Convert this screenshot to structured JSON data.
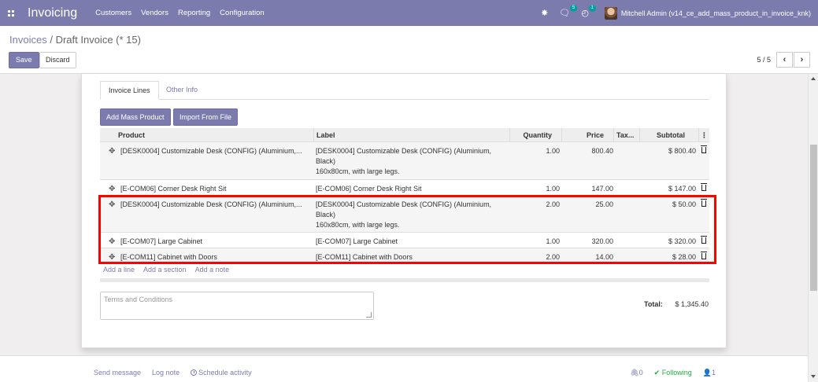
{
  "app": {
    "title": "Invoicing"
  },
  "nav": {
    "menu": [
      "Customers",
      "Vendors",
      "Reporting",
      "Configuration"
    ],
    "messages_count": "5",
    "activities_count": "1",
    "user": "Mitchell Admin (v14_ce_add_mass_product_in_invoice_knk)"
  },
  "breadcrumb": {
    "parent": "Invoices",
    "separator": "/",
    "current": "Draft Invoice (* 15)"
  },
  "actions": {
    "save": "Save",
    "discard": "Discard"
  },
  "pager": {
    "value": "5 / 5"
  },
  "tabs": [
    "Invoice Lines",
    "Other Info"
  ],
  "buttons": {
    "add_mass_product": "Add Mass Product",
    "import_from_file": "Import From File"
  },
  "columns": {
    "product": "Product",
    "label": "Label",
    "quantity": "Quantity",
    "price": "Price",
    "taxes": "Tax...",
    "subtotal": "Subtotal"
  },
  "lines": [
    {
      "product": "[DESK0004] Customizable Desk (CONFIG) (Aluminium,...",
      "label1": "[DESK0004] Customizable Desk (CONFIG) (Aluminium,",
      "label2": "Black)",
      "label3": "160x80cm, with large legs.",
      "quantity": "1.00",
      "price": "800.40",
      "subtotal": "$ 800.40"
    },
    {
      "product": "[E-COM06] Corner Desk Right Sit",
      "label1": "[E-COM06] Corner Desk Right Sit",
      "quantity": "1.00",
      "price": "147.00",
      "subtotal": "$ 147.00"
    },
    {
      "product": "[DESK0004] Customizable Desk (CONFIG) (Aluminium,...",
      "label1": "[DESK0004] Customizable Desk (CONFIG) (Aluminium,",
      "label2": "Black)",
      "label3": "160x80cm, with large legs.",
      "quantity": "2.00",
      "price": "25.00",
      "subtotal": "$ 50.00"
    },
    {
      "product": "[E-COM07] Large Cabinet",
      "label1": "[E-COM07] Large Cabinet",
      "quantity": "1.00",
      "price": "320.00",
      "subtotal": "$ 320.00"
    },
    {
      "product": "[E-COM11] Cabinet with Doors",
      "label1": "[E-COM11] Cabinet with Doors",
      "quantity": "2.00",
      "price": "14.00",
      "subtotal": "$ 28.00"
    }
  ],
  "add_links": [
    "Add a line",
    "Add a section",
    "Add a note"
  ],
  "terms_placeholder": "Terms and Conditions",
  "total": {
    "label": "Total:",
    "value": "$ 1,345.40"
  },
  "chatter": {
    "send_message": "Send message",
    "log_note": "Log note",
    "schedule_activity": "Schedule activity",
    "attachments": "0",
    "following": "Following",
    "followers": "1"
  },
  "colors": {
    "brand": "#7c7bad",
    "highlight": "#ff0000",
    "following": "#28a745"
  }
}
